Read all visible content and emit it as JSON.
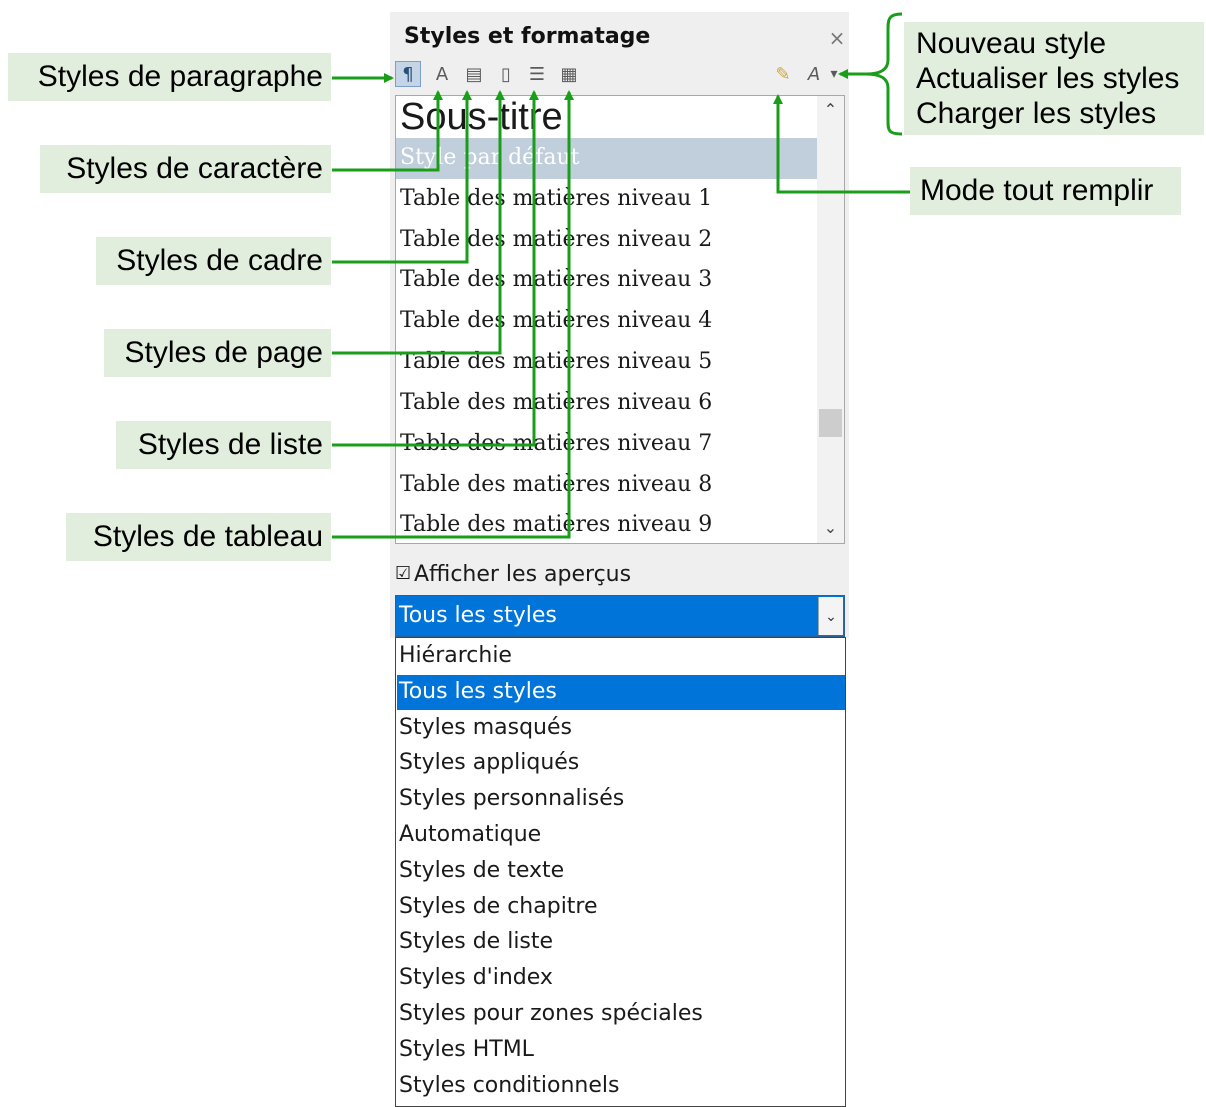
{
  "panel": {
    "title": "Styles et formatage",
    "close_icon": "×",
    "toolbar": [
      {
        "name": "paragraph-styles-icon",
        "glyph": "¶",
        "active": true
      },
      {
        "name": "character-styles-icon",
        "glyph": "A"
      },
      {
        "name": "frame-styles-icon",
        "glyph": "▤"
      },
      {
        "name": "page-styles-icon",
        "glyph": "▯"
      },
      {
        "name": "list-styles-icon",
        "glyph": "☰"
      },
      {
        "name": "table-styles-icon",
        "glyph": "▦"
      }
    ],
    "right_toolbar": [
      {
        "name": "fill-format-mode-icon",
        "glyph": "✎"
      },
      {
        "name": "styles-actions-icon",
        "glyph": "A"
      },
      {
        "name": "dropdown-arrow-icon",
        "glyph": "▾"
      }
    ]
  },
  "style_list": {
    "items": [
      "Sous-titre",
      "Style par défaut",
      "Table des matières niveau 1",
      "Table des matières niveau 2",
      "Table des matières niveau 3",
      "Table des matières niveau 4",
      "Table des matières niveau 5",
      "Table des matières niveau 6",
      "Table des matières niveau 7",
      "Table des matières niveau 8",
      "Table des matières niveau 9"
    ],
    "selected_index": 1,
    "scroll_up": "⌃",
    "scroll_down": "⌄"
  },
  "preview_checkbox": {
    "label": "Afficher les aperçus",
    "checked": true,
    "mark": "☑"
  },
  "filter": {
    "selected": "Tous les styles",
    "arrow": "⌄",
    "options": [
      "Hiérarchie",
      "Tous les styles",
      "Styles masqués",
      "Styles appliqués",
      "Styles personnalisés",
      "Automatique",
      "Styles de texte",
      "Styles de chapitre",
      "Styles de liste",
      "Styles d'index",
      "Styles pour zones spéciales",
      "Styles HTML",
      "Styles conditionnels"
    ],
    "selected_index": 1
  },
  "callouts": {
    "paragraph": "Styles de paragraphe",
    "character": "Styles de caractère",
    "frame": "Styles de cadre",
    "page": "Styles de page",
    "list": "Styles de liste",
    "table": "Styles de tableau",
    "new_style": "Nouveau style",
    "update_styles": "Actualiser les styles",
    "load_styles": "Charger les styles",
    "fill_mode": "Mode tout remplir"
  },
  "colors": {
    "accent_green": "#1a9e1a",
    "callout_bg": "#e2eedd",
    "selection_blue": "#0074d9"
  }
}
